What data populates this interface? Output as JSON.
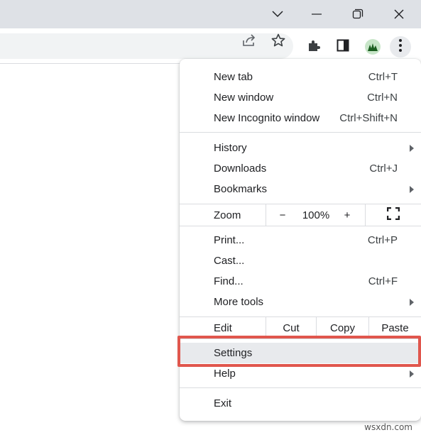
{
  "colors": {
    "titlebar": "#dee1e6",
    "highlight": "#e0564d",
    "menu_hover": "#e8eaed"
  },
  "window_controls": {
    "icons": [
      "chevron-down-icon",
      "minimize-icon",
      "restore-icon",
      "close-icon"
    ]
  },
  "toolbar": {
    "icons": [
      "share-icon",
      "bookmark-star-icon",
      "extensions-puzzle-icon",
      "side-panel-icon",
      "profile-avatar",
      "kebab-menu-icon"
    ]
  },
  "menu": {
    "new_tab": {
      "label": "New tab",
      "shortcut": "Ctrl+T"
    },
    "new_window": {
      "label": "New window",
      "shortcut": "Ctrl+N"
    },
    "new_incognito": {
      "label": "New Incognito window",
      "shortcut": "Ctrl+Shift+N"
    },
    "history": {
      "label": "History"
    },
    "downloads": {
      "label": "Downloads",
      "shortcut": "Ctrl+J"
    },
    "bookmarks": {
      "label": "Bookmarks"
    },
    "zoom": {
      "label": "Zoom",
      "minus": "−",
      "value": "100%",
      "plus": "+"
    },
    "print": {
      "label": "Print...",
      "shortcut": "Ctrl+P"
    },
    "cast": {
      "label": "Cast..."
    },
    "find": {
      "label": "Find...",
      "shortcut": "Ctrl+F"
    },
    "more_tools": {
      "label": "More tools"
    },
    "edit": {
      "label": "Edit",
      "cut": "Cut",
      "copy": "Copy",
      "paste": "Paste"
    },
    "settings": {
      "label": "Settings"
    },
    "help": {
      "label": "Help"
    },
    "exit": {
      "label": "Exit"
    }
  },
  "watermark": "wsxdn.com"
}
